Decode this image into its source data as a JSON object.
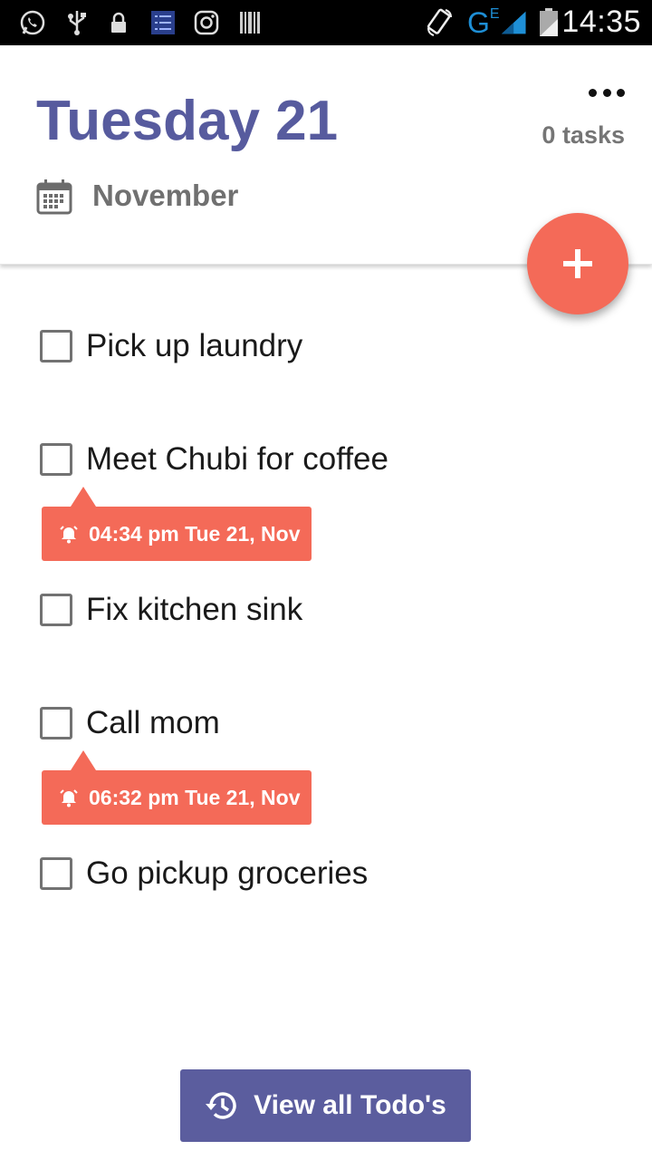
{
  "status_bar": {
    "time": "14:35",
    "network_label": "G",
    "network_sub": "E",
    "icons": [
      "whatsapp-icon",
      "usb-icon",
      "lock-icon",
      "task-app-icon",
      "instagram-icon",
      "barcode-icon",
      "rotate-icon",
      "signal-icon",
      "battery-icon"
    ]
  },
  "header": {
    "title": "Tuesday 21",
    "task_count": "0 tasks",
    "month": "November",
    "accent_color": "#575b9e",
    "fab_color": "#f46a58"
  },
  "tasks": [
    {
      "label": "Pick up laundry",
      "reminder": ""
    },
    {
      "label": "Meet Chubi for coffee",
      "reminder": "04:34 pm Tue 21, Nov"
    },
    {
      "label": "Fix kitchen sink",
      "reminder": ""
    },
    {
      "label": "Call mom",
      "reminder": "06:32 pm Tue 21, Nov"
    },
    {
      "label": "Go pickup groceries",
      "reminder": ""
    }
  ],
  "footer": {
    "view_all_label": "View all Todo's"
  }
}
